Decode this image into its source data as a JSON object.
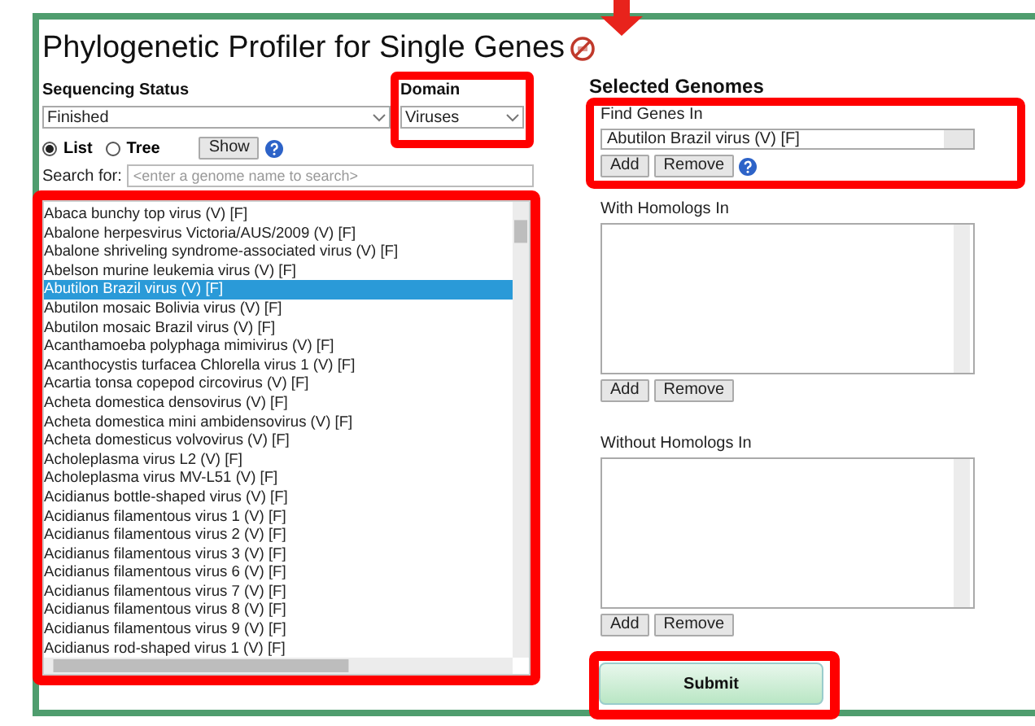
{
  "page": {
    "title": "Phylogenetic Profiler for Single Genes"
  },
  "filters": {
    "sequencing_status": {
      "label": "Sequencing Status",
      "value": "Finished",
      "highlighted": false
    },
    "domain": {
      "label": "Domain",
      "value": "Viruses",
      "highlighted": true
    }
  },
  "view_options": [
    {
      "label": "List",
      "selected": true
    },
    {
      "label": "Tree",
      "selected": false
    }
  ],
  "show_button": "Show",
  "search": {
    "label": "Search for:",
    "placeholder": "<enter a genome name to search>"
  },
  "genome_list": {
    "highlighted": true,
    "items": [
      {
        "label": "Abaca bunchy top virus (V) [F]",
        "selected": false
      },
      {
        "label": "Abalone herpesvirus Victoria/AUS/2009 (V) [F]",
        "selected": false
      },
      {
        "label": "Abalone shriveling syndrome-associated virus (V) [F]",
        "selected": false
      },
      {
        "label": "Abelson murine leukemia virus (V) [F]",
        "selected": false
      },
      {
        "label": "Abutilon Brazil virus (V) [F]",
        "selected": true
      },
      {
        "label": "Abutilon mosaic Bolivia virus (V) [F]",
        "selected": false
      },
      {
        "label": "Abutilon mosaic Brazil virus (V) [F]",
        "selected": false
      },
      {
        "label": "Acanthamoeba polyphaga mimivirus (V) [F]",
        "selected": false
      },
      {
        "label": "Acanthocystis turfacea Chlorella virus 1 (V) [F]",
        "selected": false
      },
      {
        "label": "Acartia tonsa copepod circovirus (V) [F]",
        "selected": false
      },
      {
        "label": "Acheta domestica densovirus (V) [F]",
        "selected": false
      },
      {
        "label": "Acheta domestica mini ambidensovirus (V) [F]",
        "selected": false
      },
      {
        "label": "Acheta domesticus volvovirus (V) [F]",
        "selected": false
      },
      {
        "label": "Acholeplasma virus L2 (V) [F]",
        "selected": false
      },
      {
        "label": "Acholeplasma virus MV-L51 (V) [F]",
        "selected": false
      },
      {
        "label": "Acidianus bottle-shaped virus (V) [F]",
        "selected": false
      },
      {
        "label": "Acidianus filamentous virus 1 (V) [F]",
        "selected": false
      },
      {
        "label": "Acidianus filamentous virus 2 (V) [F]",
        "selected": false
      },
      {
        "label": "Acidianus filamentous virus 3 (V) [F]",
        "selected": false
      },
      {
        "label": "Acidianus filamentous virus 6 (V) [F]",
        "selected": false
      },
      {
        "label": "Acidianus filamentous virus 7 (V) [F]",
        "selected": false
      },
      {
        "label": "Acidianus filamentous virus 8 (V) [F]",
        "selected": false
      },
      {
        "label": "Acidianus filamentous virus 9 (V) [F]",
        "selected": false
      },
      {
        "label": "Acidianus rod-shaped virus 1 (V) [F]",
        "selected": false
      }
    ]
  },
  "selected_genomes": {
    "title": "Selected Genomes",
    "groups": [
      {
        "label": "Find Genes In",
        "kind": "line",
        "values": [
          "Abutilon Brazil virus (V) [F]"
        ],
        "add": "Add",
        "remove": "Remove",
        "help": true,
        "highlighted": true
      },
      {
        "label": "With Homologs In",
        "kind": "box",
        "add": "Add",
        "remove": "Remove",
        "help": false,
        "highlighted": false
      },
      {
        "label": "Without Homologs In",
        "kind": "box",
        "add": "Add",
        "remove": "Remove",
        "help": false,
        "highlighted": false
      }
    ]
  },
  "submit": {
    "label": "Submit",
    "highlighted": true
  }
}
